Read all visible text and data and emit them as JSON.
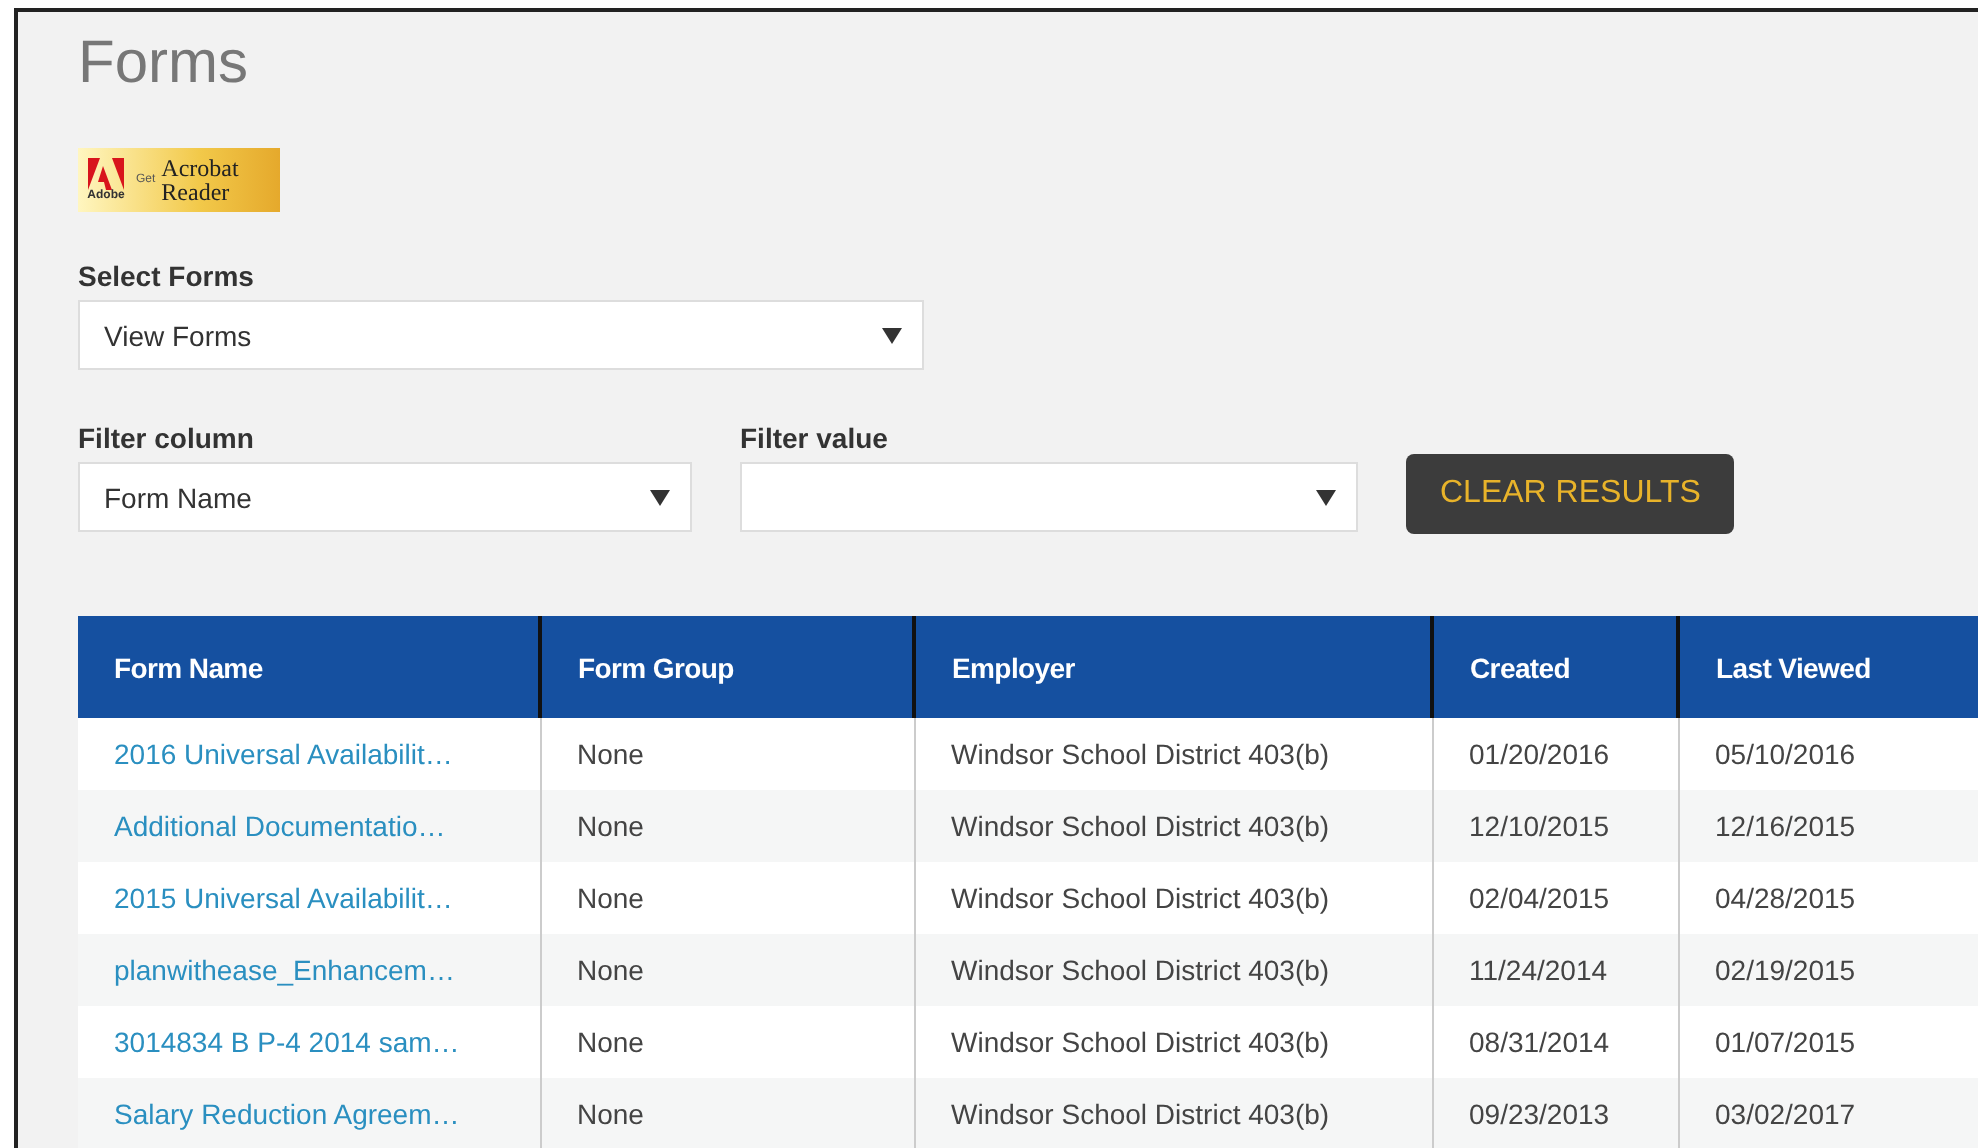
{
  "page": {
    "title": "Forms"
  },
  "acrobat_badge": {
    "brand": "Adobe",
    "get": "Get",
    "line1": "Acrobat",
    "line2": "Reader"
  },
  "select_forms": {
    "label": "Select Forms",
    "value": "View Forms"
  },
  "filter_column": {
    "label": "Filter column",
    "value": "Form Name"
  },
  "filter_value": {
    "label": "Filter value"
  },
  "clear_button": "CLEAR RESULTS",
  "table": {
    "columns": [
      "Form Name",
      "Form Group",
      "Employer",
      "Created",
      "Last Viewed"
    ],
    "rows": [
      [
        "2016 Universal Availabilit…",
        "None",
        "Windsor School District 403(b)",
        "01/20/2016",
        "05/10/2016"
      ],
      [
        "Additional Documentatio…",
        "None",
        "Windsor School District 403(b)",
        "12/10/2015",
        "12/16/2015"
      ],
      [
        "2015 Universal Availabilit…",
        "None",
        "Windsor School District 403(b)",
        "02/04/2015",
        "04/28/2015"
      ],
      [
        "planwithease_Enhancem…",
        "None",
        "Windsor School District 403(b)",
        "11/24/2014",
        "02/19/2015"
      ],
      [
        "3014834 B P-4 2014 sam…",
        "None",
        "Windsor School District 403(b)",
        "08/31/2014",
        "01/07/2015"
      ],
      [
        "Salary Reduction Agreem…",
        "None",
        "Windsor School District 403(b)",
        "09/23/2013",
        "03/02/2017"
      ]
    ]
  }
}
